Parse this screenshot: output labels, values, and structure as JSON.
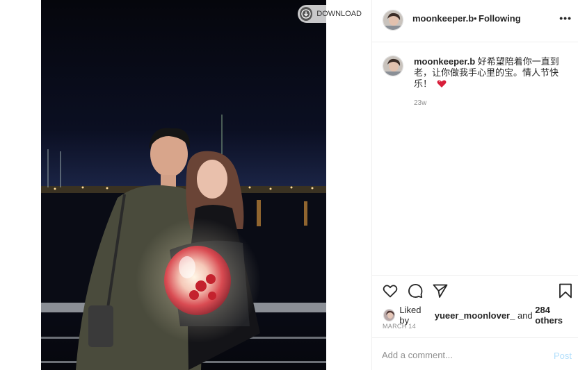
{
  "download": {
    "label": "DOWNLOAD",
    "icon": "download-icon"
  },
  "header": {
    "username": "moonkeeper.b",
    "separator": "•",
    "follow_status": "Following",
    "more_label": "•••"
  },
  "caption": {
    "username": "moonkeeper.b",
    "text": "好希望陪着你一直到老，让你做我手心里的宝。情人节快乐！",
    "time_ago": "23w"
  },
  "actions": {
    "like_icon": "heart-icon",
    "comment_icon": "comment-icon",
    "share_icon": "share-icon",
    "save_icon": "bookmark-icon"
  },
  "likes": {
    "prefix": "Liked by",
    "user": "yueer_moonlover_",
    "connector": "and",
    "others": "284 others"
  },
  "date": "MARCH 14",
  "comment": {
    "placeholder": "Add a comment...",
    "post_label": "Post"
  },
  "colors": {
    "link_disabled": "#b2dffc",
    "text": "#262626",
    "muted": "#8e8e8e",
    "border": "#efefef",
    "heart_emoji": "#d81e3a"
  }
}
